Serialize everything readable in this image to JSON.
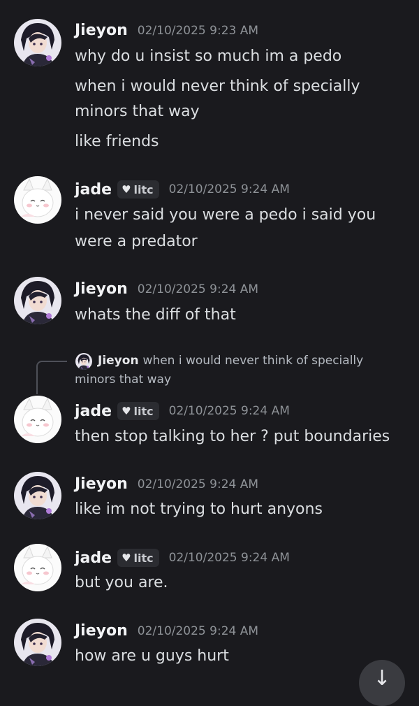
{
  "messages": [
    {
      "author": "Jieyon",
      "timestamp": "02/10/2025 9:23 AM",
      "lines": [
        "why do u insist so much im a pedo",
        "when i would never think of specially",
        "minors that way",
        "like friends"
      ]
    },
    {
      "author": "jade",
      "tag": "litc",
      "timestamp": "02/10/2025 9:24 AM",
      "lines": [
        "i never said you were a pedo i said you",
        "were a predator"
      ]
    },
    {
      "author": "Jieyon",
      "timestamp": "02/10/2025 9:24 AM",
      "lines": [
        "whats the diff of that"
      ]
    },
    {
      "author": "jade",
      "tag": "litc",
      "timestamp": "02/10/2025 9:24 AM",
      "reply": {
        "author": "Jieyon",
        "text_line1": "when i would never think of specially",
        "text_line2": "minors that way"
      },
      "lines": [
        "then stop talking to her ? put boundaries"
      ]
    },
    {
      "author": "Jieyon",
      "timestamp": "02/10/2025 9:24 AM",
      "lines": [
        "like im not trying to hurt anyons"
      ]
    },
    {
      "author": "jade",
      "tag": "litc",
      "timestamp": "02/10/2025 9:24 AM",
      "lines": [
        "but you are."
      ]
    },
    {
      "author": "Jieyon",
      "timestamp": "02/10/2025 9:24 AM",
      "lines": [
        "how are u guys hurt"
      ]
    }
  ],
  "icons": {
    "tag_icon": "heart-icon",
    "jump_icon": "arrow-down-icon"
  },
  "colors": {
    "background": "#1a1a1e",
    "timestamp": "#8e9297",
    "tag_bg": "#2b2c31"
  }
}
